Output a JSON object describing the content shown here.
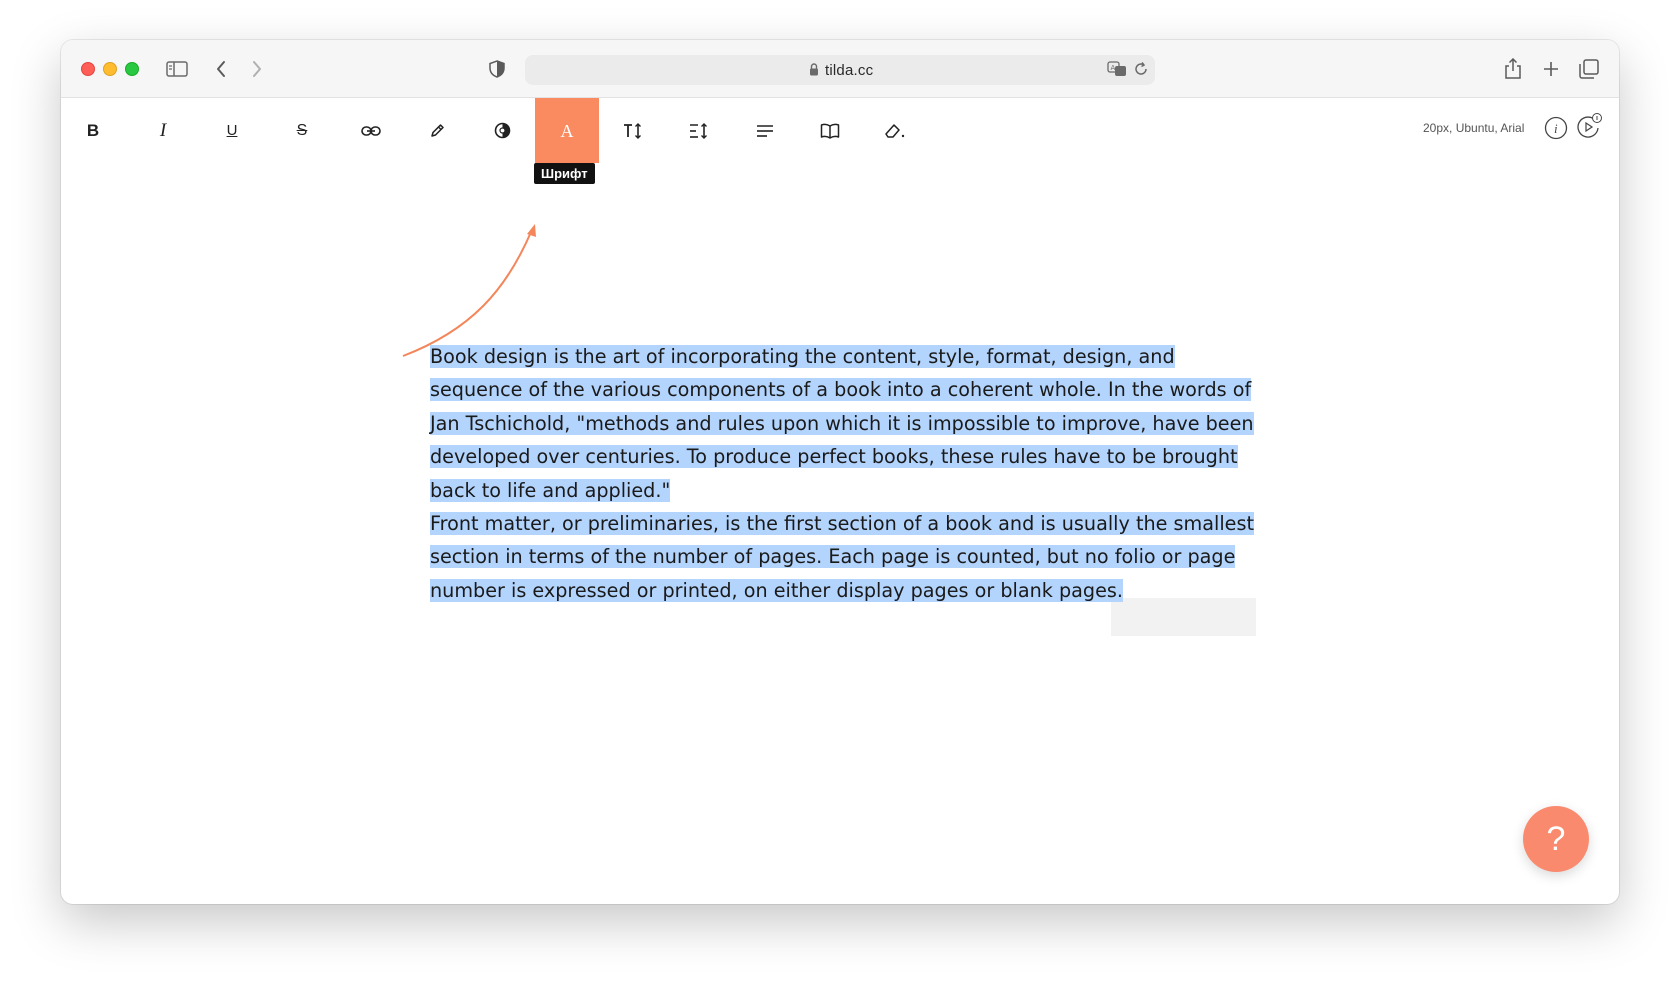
{
  "browser": {
    "url": "tilda.cc",
    "icons": [
      "sidebar-icon",
      "back-icon",
      "forward-icon",
      "shield-icon",
      "lock-icon",
      "translate-icon",
      "reload-icon",
      "share-icon",
      "new-tab-icon",
      "tabs-overview-icon"
    ]
  },
  "toolbar": {
    "tools": [
      {
        "name": "bold",
        "glyph": "B"
      },
      {
        "name": "italic",
        "glyph": "I"
      },
      {
        "name": "underline",
        "glyph": "U"
      },
      {
        "name": "strikethrough",
        "glyph": "S"
      },
      {
        "name": "link",
        "glyph": "link"
      },
      {
        "name": "color-pencil",
        "glyph": "pencil"
      },
      {
        "name": "background-color",
        "glyph": "circle"
      },
      {
        "name": "font",
        "glyph": "A",
        "active": true
      },
      {
        "name": "font-size",
        "glyph": "TI"
      },
      {
        "name": "line-height",
        "glyph": "line-height"
      },
      {
        "name": "align",
        "glyph": "align"
      },
      {
        "name": "typograph",
        "glyph": "book"
      },
      {
        "name": "clear-format",
        "glyph": "eraser"
      }
    ],
    "tooltip": "Шрифт",
    "font_info": "20px, Ubuntu, Arial",
    "accent_color": "#fa8a5f"
  },
  "content": {
    "paragraph_1": "Book design is the art of incorporating the content, style, format, design, and sequence of the various components of a book into a coherent whole. In the words of Jan Tschichold, \"methods and rules upon which it is impossible to improve, have been developed over centuries. To produce perfect books, these rules have to be brought back to life and applied.\"",
    "paragraph_2": "Front matter, or preliminaries, is the first section of a book and is usually the smallest section in terms of the number of pages. Each page is counted, but no folio or page number is expressed or printed, on either display pages or blank pages.",
    "selection_color": "#b3d4fd"
  },
  "help": {
    "label": "?"
  }
}
